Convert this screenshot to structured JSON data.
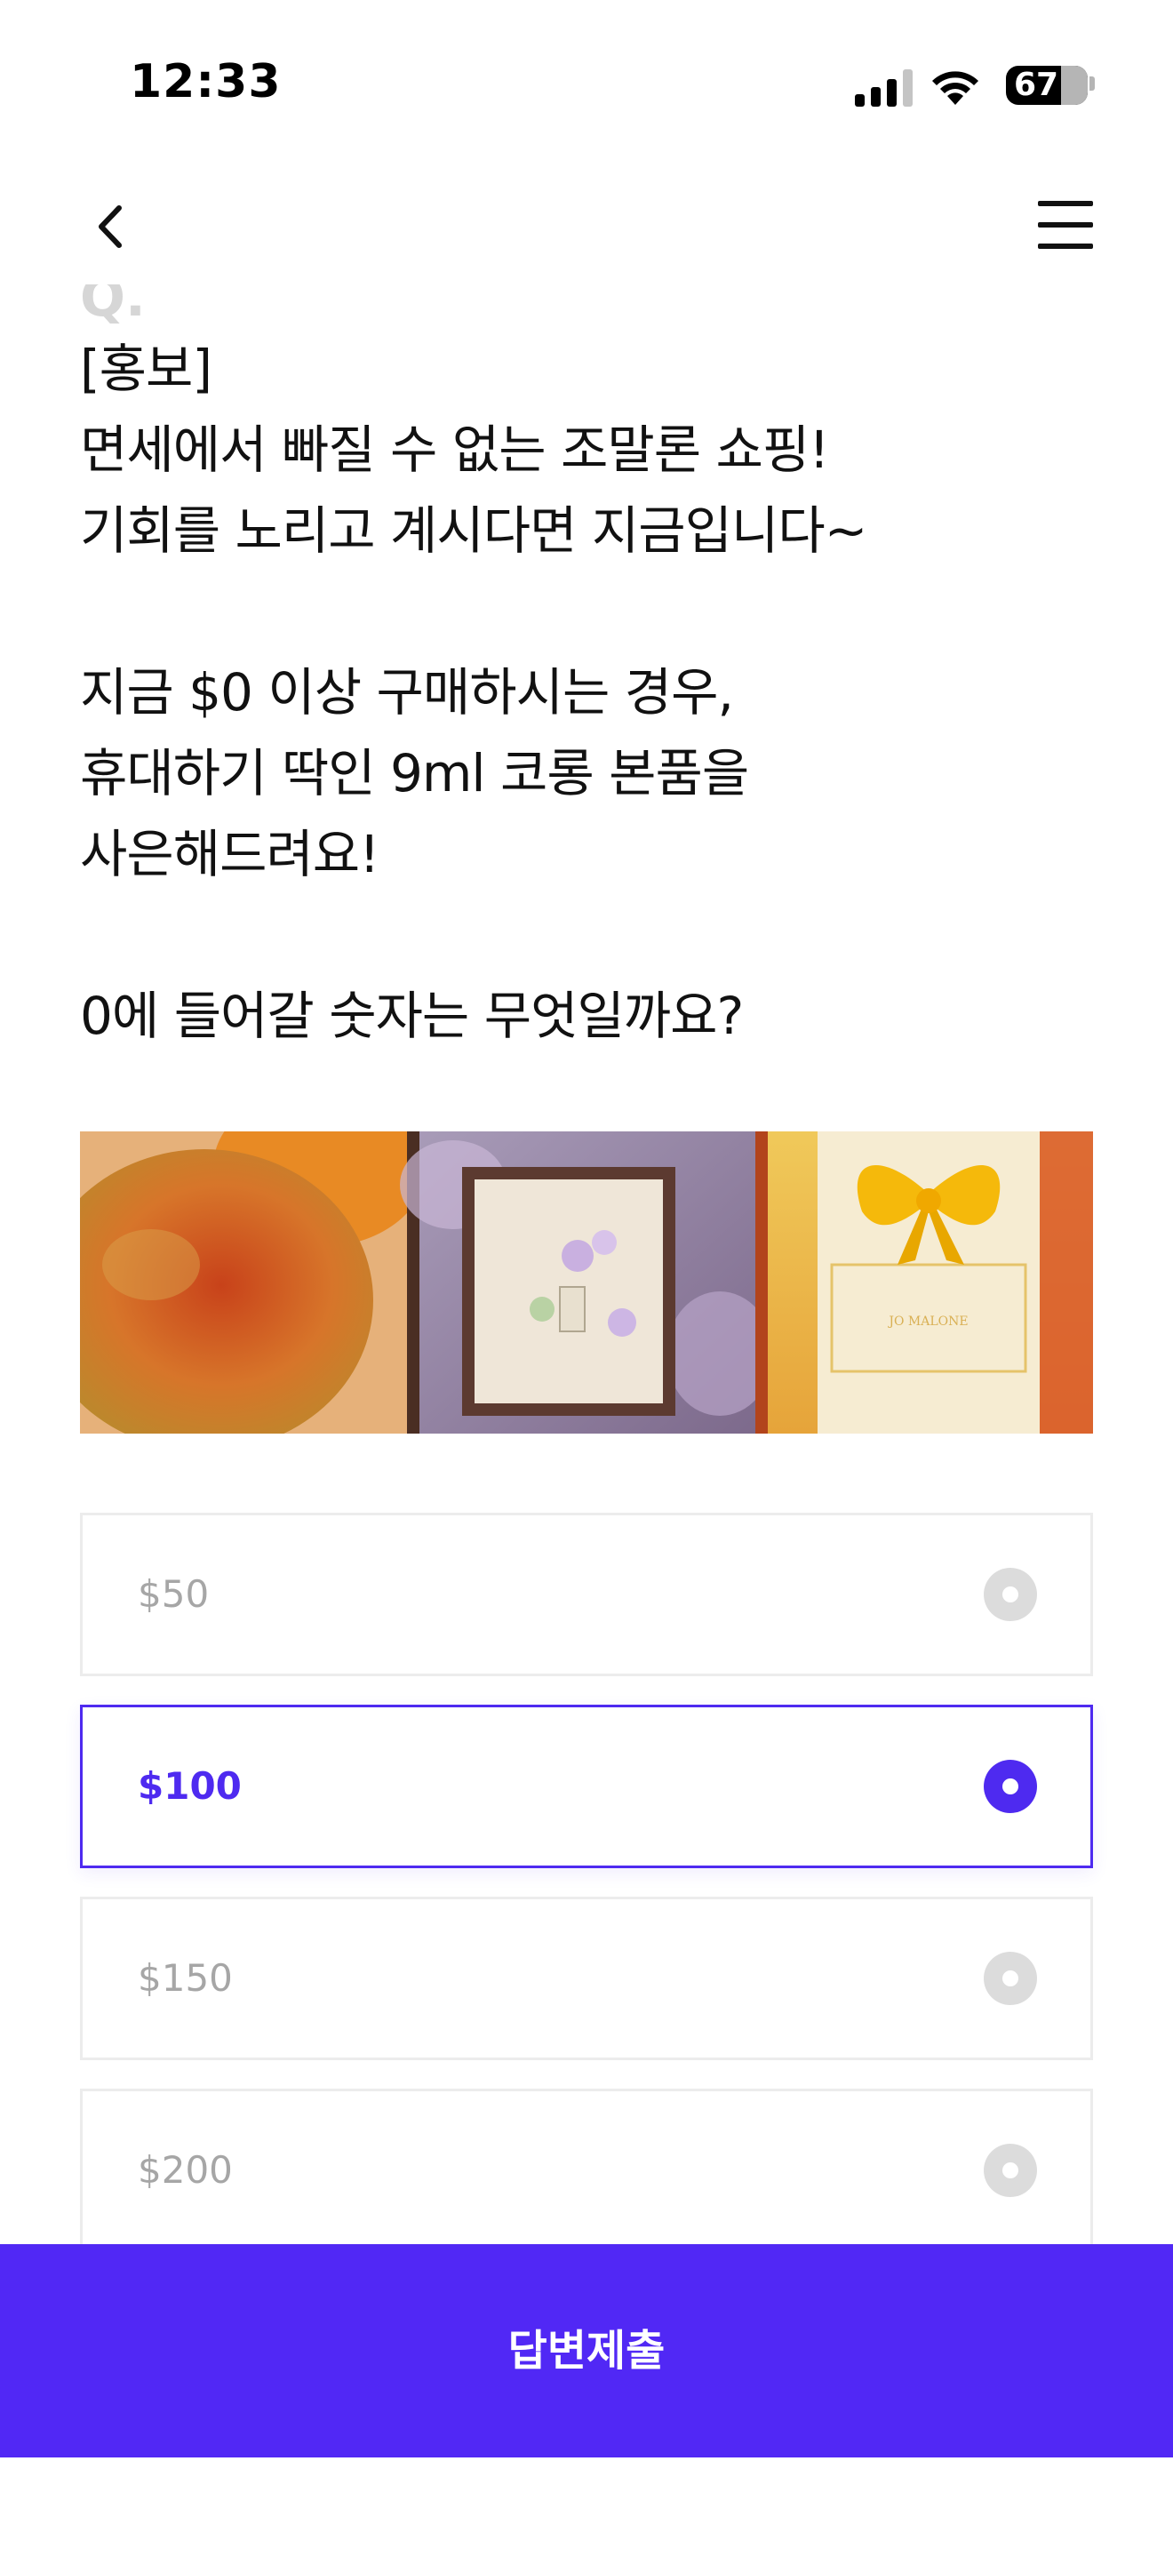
{
  "status_bar": {
    "time": "12:33",
    "battery": "67",
    "icons": [
      "cellular-signal-icon",
      "wifi-icon",
      "battery-icon"
    ]
  },
  "nav": {
    "back_icon": "chevron-left-icon",
    "menu_icon": "hamburger-menu-icon"
  },
  "question": {
    "label_faded": "Q.",
    "text": "[홍보]\n면세에서 빠질 수 없는 조말론 쇼핑!\n기회를 노리고 계시다면 지금입니다~\n\n지금 $0 이상 구매하시는 경우,\n휴대하기 딱인 9ml 코롱 본품을\n사은해드려요!\n\n0에 들어갈 숫자는 무엇일까요?"
  },
  "promo_image": {
    "description_icon": "product-banner-image",
    "box_text": "JO MALONE"
  },
  "options": [
    {
      "label": "$50",
      "selected": false
    },
    {
      "label": "$100",
      "selected": true
    },
    {
      "label": "$150",
      "selected": false
    },
    {
      "label": "$200",
      "selected": false
    }
  ],
  "submit": {
    "label": "답변제출"
  },
  "colors": {
    "accent": "#5128f5",
    "option_border": "#ececec",
    "option_text": "#a6a6a6"
  }
}
